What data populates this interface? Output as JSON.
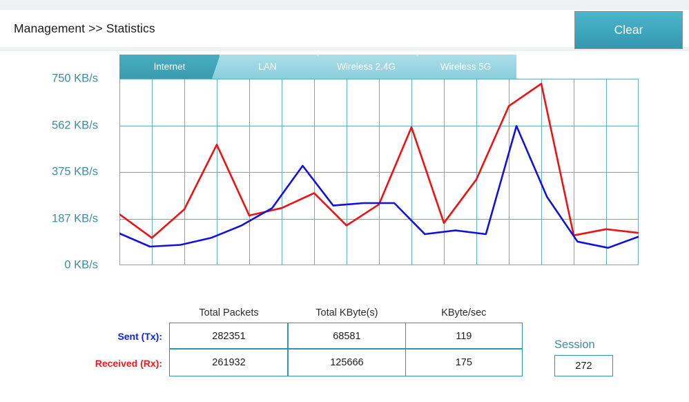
{
  "header": {
    "breadcrumb": "Management >> Statistics",
    "clear_label": "Clear"
  },
  "tabs": [
    {
      "id": "internet",
      "label": "Internet",
      "active": true
    },
    {
      "id": "lan",
      "label": "LAN",
      "active": false
    },
    {
      "id": "wireless24",
      "label": "Wireless 2.4G",
      "active": false
    },
    {
      "id": "wireless5",
      "label": "Wireless 5G",
      "active": false
    }
  ],
  "colors": {
    "accent_teal": "#3d8da1",
    "tab_active": "#3b9cb0",
    "tab_inactive": "#8ccedc",
    "grid": "#62aec2",
    "tx_blue": "#1111dd",
    "rx_red": "#ee1111",
    "button_teal": "#3da6bd"
  },
  "chart_data": {
    "type": "line",
    "title": "",
    "xlabel": "",
    "ylabel": "KB/s",
    "ylim": [
      0,
      750
    ],
    "yticks": [
      0,
      187,
      375,
      562,
      750
    ],
    "ytick_labels": [
      "0 KB/s",
      "187 KB/s",
      "375 KB/s",
      "562 KB/s",
      "750 KB/s"
    ],
    "grid": true,
    "x_gridline_count": 16,
    "legend": "none",
    "x": [
      0,
      1,
      2,
      3,
      4,
      5,
      6,
      7,
      8,
      9,
      10,
      11,
      12,
      13,
      14,
      15,
      16
    ],
    "series": [
      {
        "name": "Received (Rx)",
        "color": "#ee1111",
        "values": [
          205,
          110,
          225,
          485,
          200,
          230,
          290,
          160,
          245,
          555,
          170,
          345,
          640,
          730,
          120,
          145,
          130
        ]
      },
      {
        "name": "Sent (Tx)",
        "color": "#1111dd",
        "values": [
          128,
          75,
          82,
          110,
          160,
          230,
          400,
          240,
          250,
          250,
          125,
          140,
          125,
          560,
          275,
          95,
          70,
          115
        ]
      }
    ]
  },
  "stats_table": {
    "column_headers": [
      "Total Packets",
      "Total KByte(s)",
      "KByte/sec"
    ],
    "rows": [
      {
        "label": "Sent (Tx):",
        "values": [
          "282351",
          "68581",
          "119"
        ]
      },
      {
        "label": "Received (Rx):",
        "values": [
          "261932",
          "125666",
          "175"
        ]
      }
    ]
  },
  "session": {
    "label": "Session",
    "value": "272"
  }
}
